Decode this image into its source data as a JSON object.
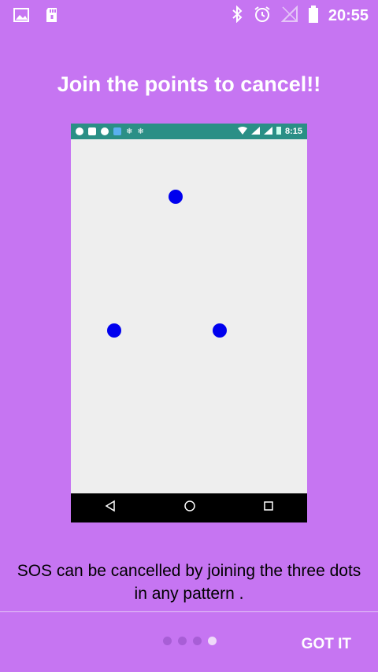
{
  "status_bar": {
    "time": "20:55",
    "left_icons": [
      "image-icon",
      "sd-card-icon"
    ],
    "right_icons": [
      "bluetooth-icon",
      "alarm-icon",
      "signal-icon",
      "battery-icon"
    ]
  },
  "title": "Join the points to cancel!!",
  "phone_preview": {
    "status_time": "8:15",
    "status_color": "#2a8f86",
    "dot_color": "#0000ee",
    "nav_icons": [
      "back-icon",
      "home-icon",
      "recents-icon"
    ]
  },
  "description": {
    "line1": "SOS can be cancelled by joining the three dots",
    "line2": "in any pattern ."
  },
  "pager": {
    "total": 4,
    "current_index": 3
  },
  "actions": {
    "got_it_label": "GOT IT"
  }
}
